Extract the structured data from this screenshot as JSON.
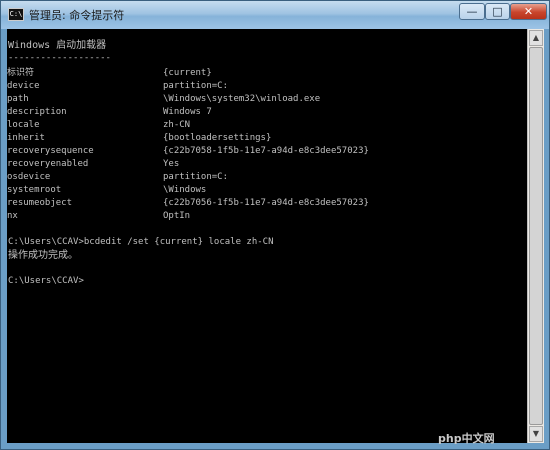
{
  "window": {
    "title": "管理员: 命令提示符",
    "icon_label": "C:\\",
    "controls": {
      "minimize": "—",
      "maximize": "□",
      "close": "✕"
    }
  },
  "console": {
    "heading": "Windows 启动加载器",
    "separator": "-------------------",
    "entries": [
      {
        "key": "标识符",
        "value": "{current}"
      },
      {
        "key": "device",
        "value": "partition=C:"
      },
      {
        "key": "path",
        "value": "\\Windows\\system32\\winload.exe"
      },
      {
        "key": "description",
        "value": "Windows 7"
      },
      {
        "key": "locale",
        "value": "zh-CN"
      },
      {
        "key": "inherit",
        "value": "{bootloadersettings}"
      },
      {
        "key": "recoverysequence",
        "value": "{c22b7058-1f5b-11e7-a94d-e8c3dee57023}"
      },
      {
        "key": "recoveryenabled",
        "value": "Yes"
      },
      {
        "key": "osdevice",
        "value": "partition=C:"
      },
      {
        "key": "systemroot",
        "value": "\\Windows"
      },
      {
        "key": "resumeobject",
        "value": "{c22b7056-1f5b-11e7-a94d-e8c3dee57023}"
      },
      {
        "key": "nx",
        "value": "OptIn"
      }
    ],
    "command_line": "C:\\Users\\CCAV>bcdedit /set {current} locale zh-CN",
    "result": "操作成功完成。",
    "prompt": "C:\\Users\\CCAV>"
  },
  "watermark": "php中文网"
}
